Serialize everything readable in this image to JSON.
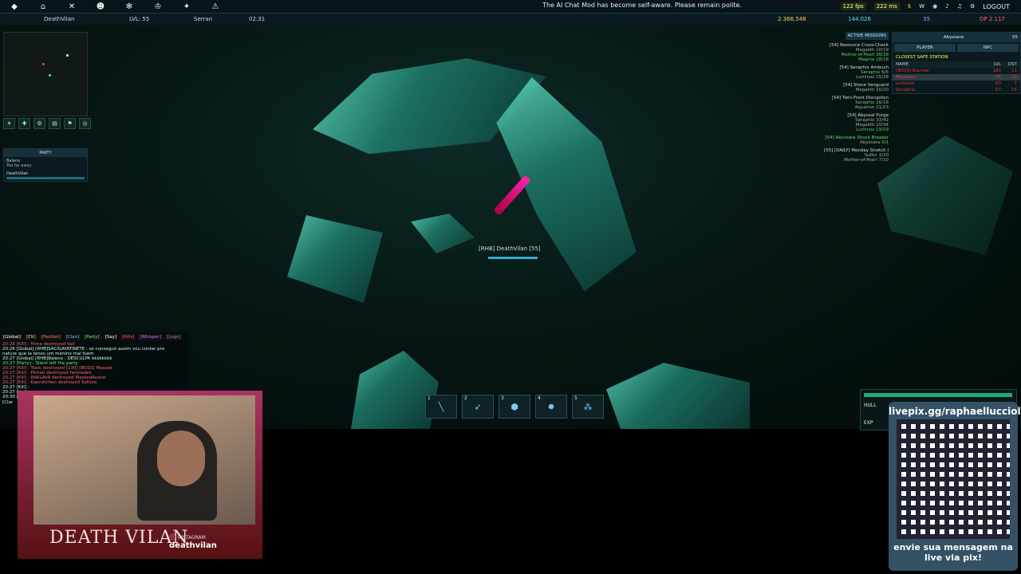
{
  "topbar": {
    "nav_icons": [
      "ship-icon",
      "home-icon",
      "crossed-tools-icon",
      "group-icon",
      "settings-icon",
      "trophy-icon",
      "medal-icon",
      "alert-icon"
    ],
    "ticker": "The AI Chat Mod has become self-aware. Please remain polite.",
    "fps": "122 fps",
    "ping": "222 ms",
    "logout": "LOGOUT"
  },
  "status": {
    "player": "DeathVilan",
    "level": "LVL: 55",
    "faction": "Serran",
    "time": "02:31",
    "credits": "2.366.548",
    "gems": "144.026",
    "tokens": "35",
    "dp": "DP 2.117"
  },
  "party": {
    "title": "PARTY",
    "members": [
      {
        "name": "Baleno",
        "note": "Too far away"
      },
      {
        "name": "DeathVilan",
        "note": ""
      }
    ]
  },
  "missions": {
    "header": "ACTIVE MISSIONS",
    "items": [
      {
        "title": "[54] Resource Cross-Check",
        "lines": [
          "Megalith 10/19",
          "Mother-of-Pearl 38/38",
          "Magma 18/18"
        ]
      },
      {
        "title": "[54] Seraphix Ambush",
        "lines": [
          "Seraphix 6/6",
          "Luminox 15/28"
        ]
      },
      {
        "title": "[54] Stone Vanguard",
        "lines": [
          "Megalith 10/20"
        ]
      },
      {
        "title": "[54] Twin-Front Disruption",
        "lines": [
          "Seraphix 16/16",
          "Aquarion 21/23"
        ]
      },
      {
        "title": "[54] Abyssal Purge",
        "lines": [
          "Seraphix 33/42",
          "Megalith 10/34",
          "Luminox 19/19"
        ]
      },
      {
        "title": "[54] Abyssara Shock Breaker",
        "lines": [
          "Abyssara 0/1"
        ]
      },
      {
        "title": "[55] [DAILY] Monday Stretch I",
        "lines": [
          "Sulfur 3/20",
          "Mother-of-Pearl 7/10"
        ]
      }
    ]
  },
  "target": {
    "name": "Abyssara",
    "level": "55",
    "tabs": [
      "PLAYER",
      "NPC"
    ],
    "safe_station": "CLOSEST SAFE STATION",
    "columns": [
      "NAME",
      "LVL",
      "DST"
    ],
    "rows": [
      {
        "name": "[BOSS] Baumar",
        "lvl": "180",
        "dst": "11"
      },
      {
        "name": "Abyssara",
        "lvl": "55",
        "dst": "20"
      },
      {
        "name": "Luminox",
        "lvl": "60",
        "dst": "7"
      },
      {
        "name": "Seraphix",
        "lvl": "57",
        "dst": "15"
      }
    ]
  },
  "ship": {
    "label": "[RHB] DeathVilan [55]"
  },
  "hotbar": [
    {
      "num": "1",
      "icon": "laser-icon"
    },
    {
      "num": "2",
      "icon": "missile-icon"
    },
    {
      "num": "3",
      "icon": "shield-icon"
    },
    {
      "num": "4",
      "icon": "mine-icon"
    },
    {
      "num": "5",
      "icon": "cluster-icon"
    }
  ],
  "hull": {
    "hull_label": "HULL",
    "exp_label": "EXP"
  },
  "chat": {
    "tabs": [
      "[Global]",
      "[EN]",
      "[Faction]",
      "[Clan]",
      "[Party]",
      "[Say]",
      "[Kills]",
      "[Whisper]",
      "[Logs]"
    ],
    "lines": [
      "20:26 [Kill] : Hime destroyed Vali",
      "20:26 [Global] [RHB]SACIGAYATINETE : se conseguir assim vou contar pro",
      "nature que la tenso um menino mal fuem",
      "20:27 [Global] [RHB]Baleno : DESCULPA kkkkkkkk",
      "20:27 [Party] : Silent left the party",
      "20:27 [Kill] : Toxic destroyed [130] [BOSS] Massak",
      "20:27 [Kill] : Pichon destroyed hennedah",
      "20:27 [Kill] : BAKLAVA destroyed MaskedAvatar",
      "20:27 [Kill] : Kaersitchen destroyed Soltoro",
      "20:27 [Kill] :",
      "20:27 [Jan] :",
      "20:30 [Kill] :"
    ],
    "clan_btn": "[Clar"
  },
  "webcam": {
    "brand": "DEATH VILAN",
    "social_label": "INSTAGRAM",
    "social_handle": "deathvilan"
  },
  "donation": {
    "url": "livepix.gg/raphaellucciola",
    "message": "envie sua mensagem na live via pix!"
  }
}
